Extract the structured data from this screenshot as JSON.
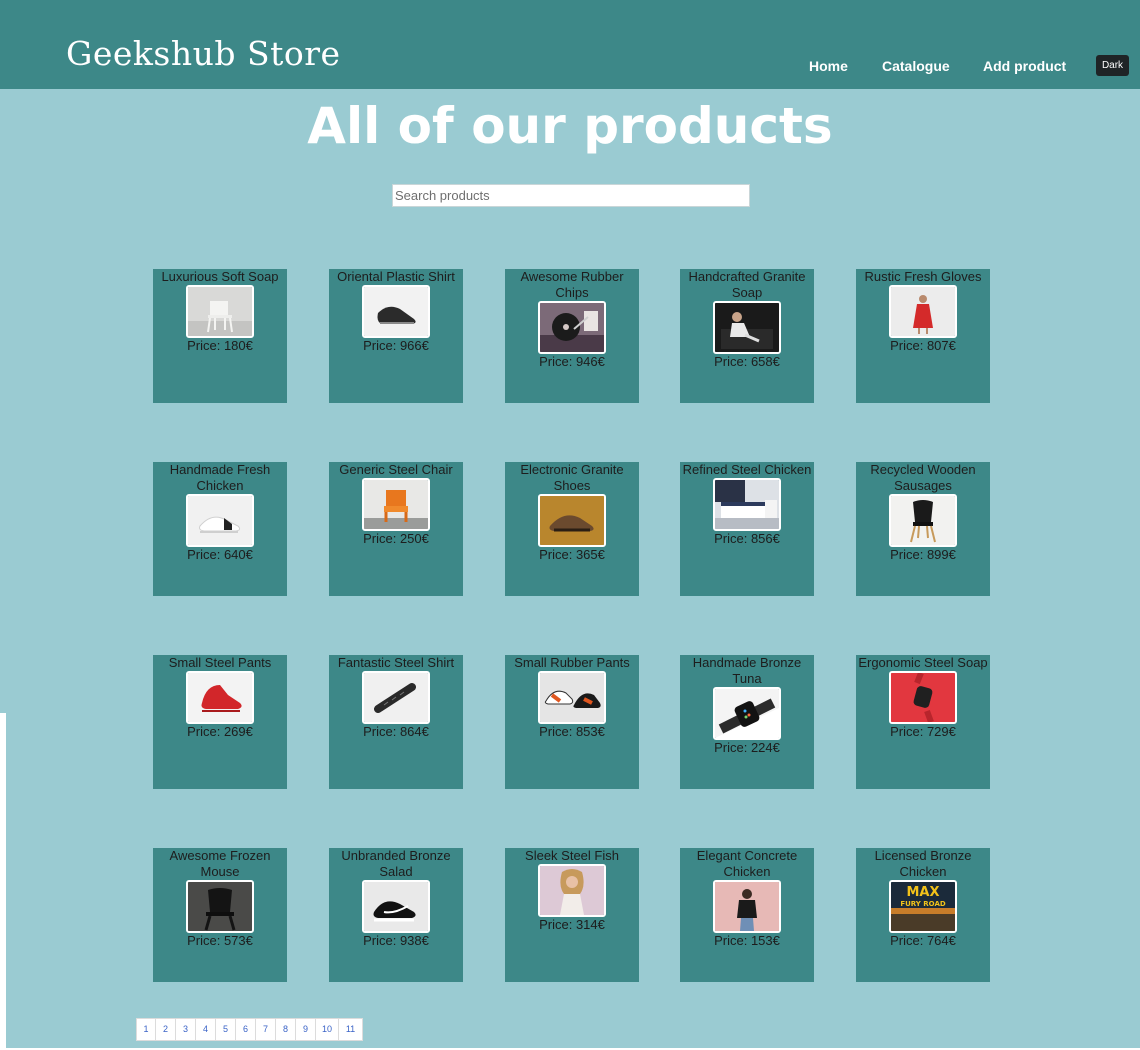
{
  "header": {
    "brand": "Geekshub Store",
    "nav": [
      "Home",
      "Catalogue",
      "Add product"
    ],
    "theme_toggle": "Dark"
  },
  "main": {
    "title": "All of our products",
    "search_placeholder": "Search products"
  },
  "products": [
    {
      "name": "Luxurious Soft Soap",
      "price": "Price: 180€",
      "image": "white-chair-photo"
    },
    {
      "name": "Oriental Plastic Shirt",
      "price": "Price: 966€",
      "image": "black-sneaker-photo"
    },
    {
      "name": "Awesome Rubber Chips",
      "price": "Price: 946€",
      "image": "turntable-photo"
    },
    {
      "name": "Handcrafted Granite Soap",
      "price": "Price: 658€",
      "image": "person-sitting-photo"
    },
    {
      "name": "Rustic Fresh Gloves",
      "price": "Price: 807€",
      "image": "red-dress-person-photo"
    },
    {
      "name": "Handmade Fresh Chicken",
      "price": "Price: 640€",
      "image": "white-sneaker-photo"
    },
    {
      "name": "Generic Steel Chair",
      "price": "Price: 250€",
      "image": "orange-chair-photo"
    },
    {
      "name": "Electronic Granite Shoes",
      "price": "Price: 365€",
      "image": "brown-shoes-photo"
    },
    {
      "name": "Refined Steel Chicken",
      "price": "Price: 856€",
      "image": "bedroom-photo"
    },
    {
      "name": "Recycled Wooden Sausages",
      "price": "Price: 899€",
      "image": "black-chair-photo"
    },
    {
      "name": "Small Steel Pants",
      "price": "Price: 269€",
      "image": "red-sneaker-photo"
    },
    {
      "name": "Fantastic Steel Shirt",
      "price": "Price: 864€",
      "image": "watch-band-photo"
    },
    {
      "name": "Small Rubber Pants",
      "price": "Price: 853€",
      "image": "jordan-sneakers-photo"
    },
    {
      "name": "Handmade Bronze Tuna",
      "price": "Price: 224€",
      "image": "smartwatch-photo"
    },
    {
      "name": "Ergonomic Steel Soap",
      "price": "Price: 729€",
      "image": "red-watch-photo"
    },
    {
      "name": "Awesome Frozen Mouse",
      "price": "Price: 573€",
      "image": "dark-chair-photo"
    },
    {
      "name": "Unbranded Bronze Salad",
      "price": "Price: 938€",
      "image": "nike-sneaker-photo"
    },
    {
      "name": "Sleek Steel Fish",
      "price": "Price: 314€",
      "image": "woman-portrait-photo"
    },
    {
      "name": "Elegant Concrete Chicken",
      "price": "Price: 153€",
      "image": "woman-pink-wall-photo"
    },
    {
      "name": "Licensed Bronze Chicken",
      "price": "Price: 764€",
      "image": "mad-max-poster"
    }
  ],
  "poster_text": {
    "line1": "MAX",
    "line2": "FURY ROAD"
  },
  "pagination": [
    "1",
    "2",
    "3",
    "4",
    "5",
    "6",
    "7",
    "8",
    "9",
    "10",
    "11"
  ],
  "colors": {
    "header": "#3d8888",
    "background": "#9acbd2",
    "card": "#3d8888",
    "dark_button": "#1f2426",
    "page_link": "#3a63c7"
  }
}
